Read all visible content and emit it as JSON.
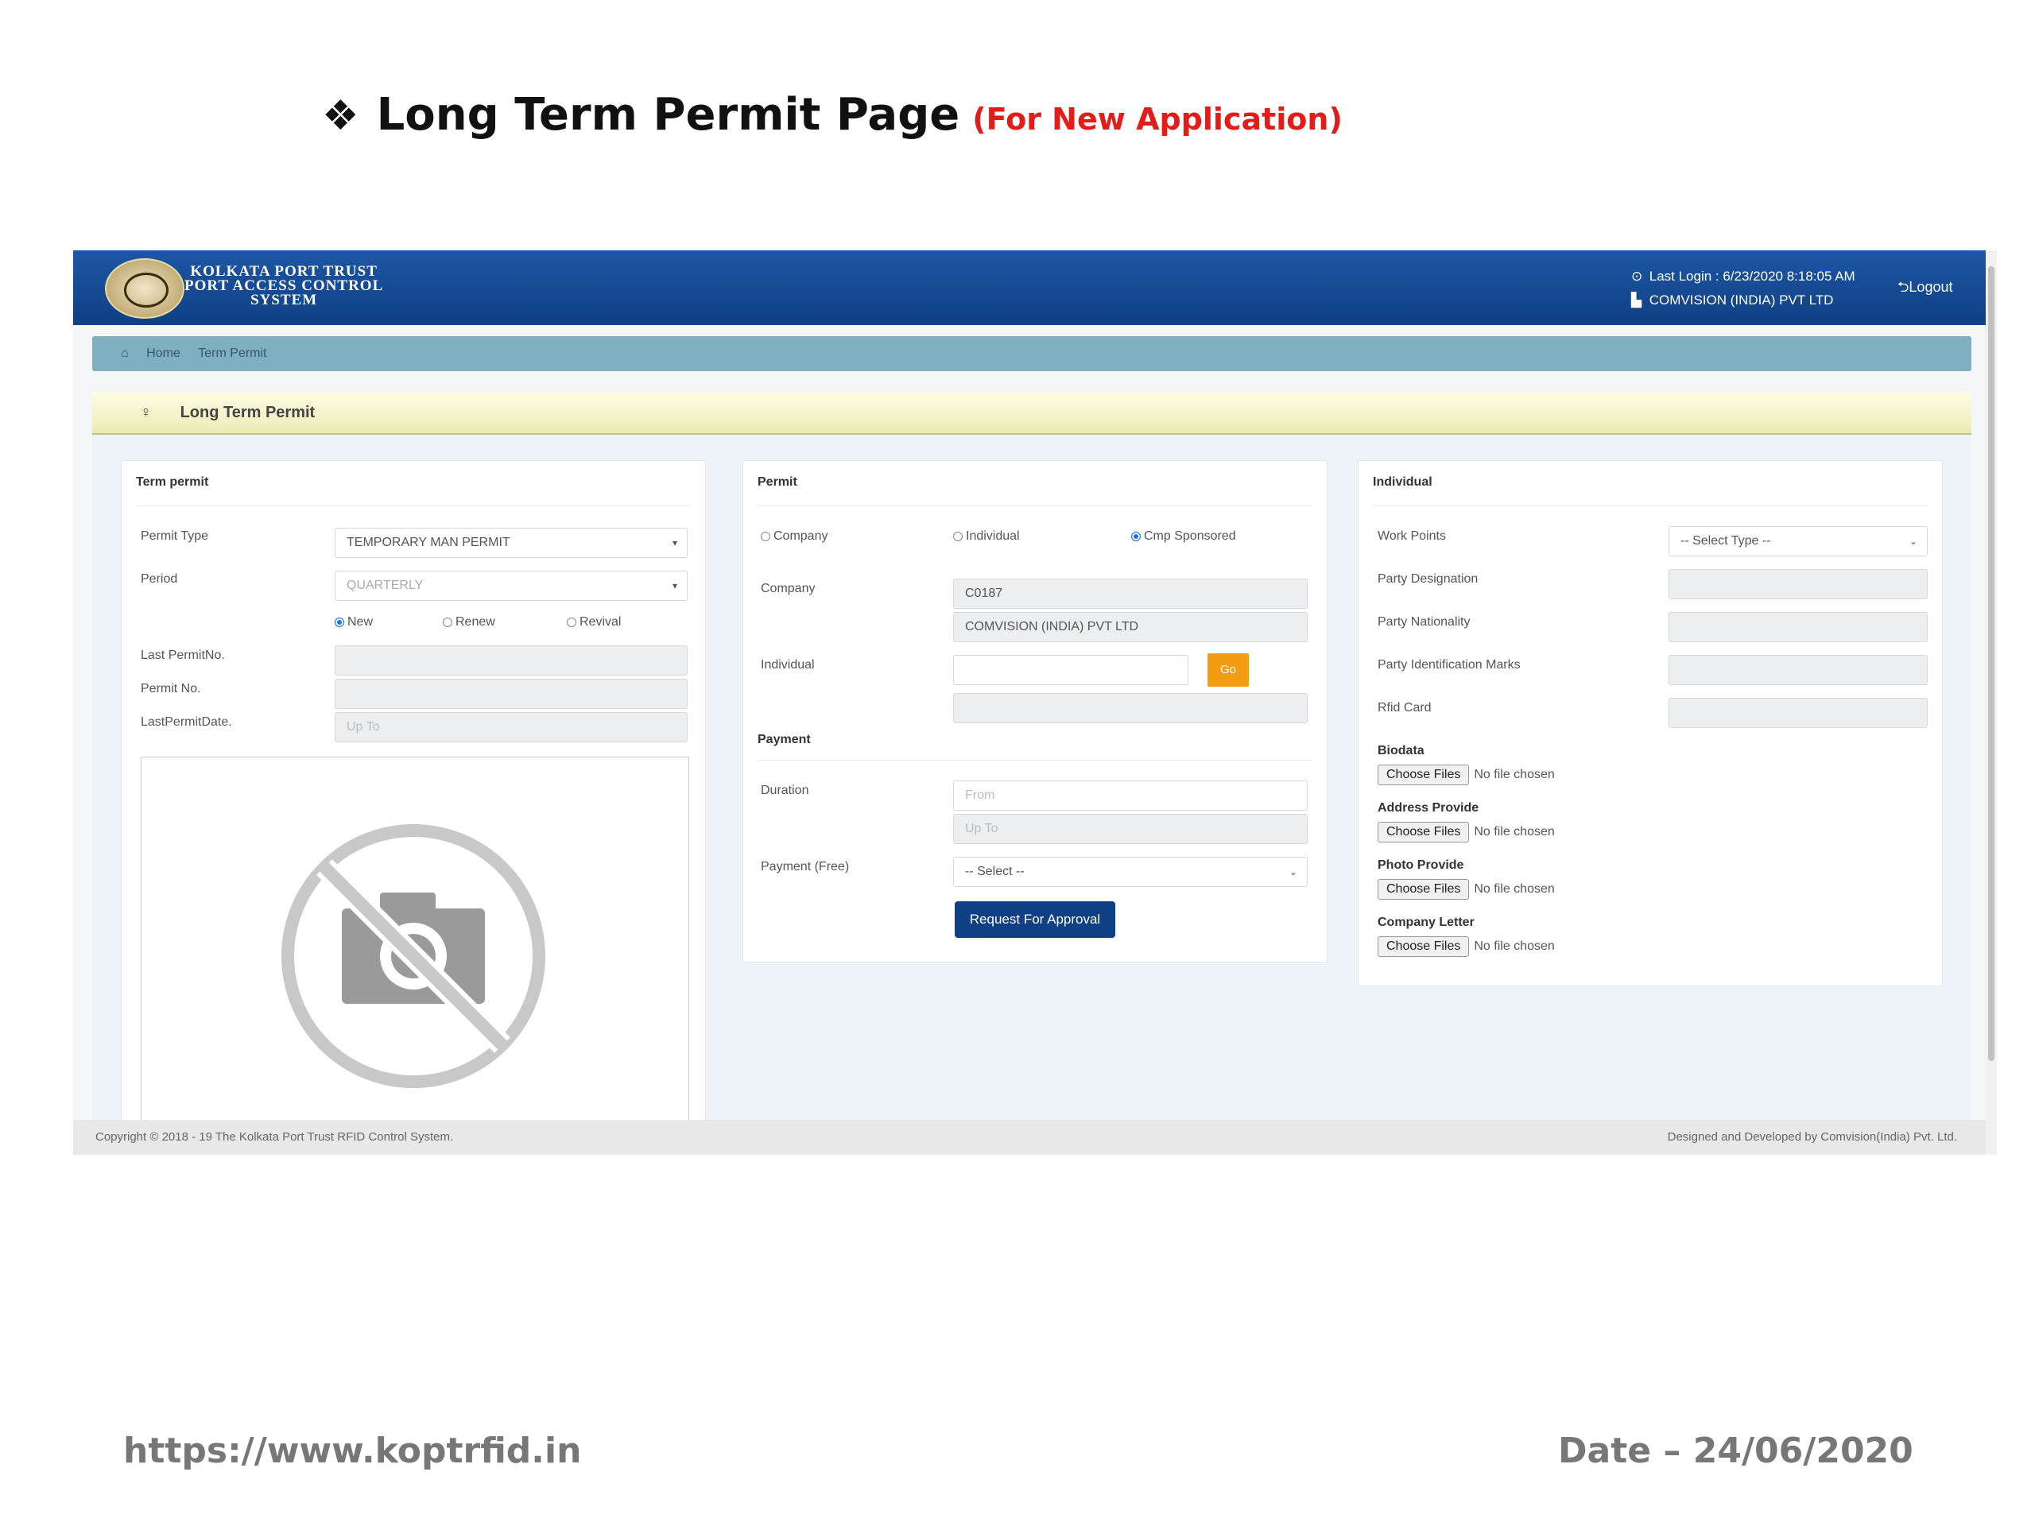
{
  "slide": {
    "bullet": "❖",
    "title": "Long Term Permit Page",
    "subtitle": "(For New Application)",
    "url": "https://www.koptrfid.in",
    "date": "Date – 24/06/2020"
  },
  "header": {
    "brand_line1": "KOLKATA PORT TRUST",
    "brand_line2": "PORT ACCESS CONTROL",
    "brand_line3": "SYSTEM",
    "last_login": "Last Login : 6/23/2020 8:18:05 AM",
    "company": "COMVISION (INDIA) PVT LTD",
    "logout": "Logout"
  },
  "breadcrumb": {
    "home": "Home",
    "current": "Term Permit"
  },
  "panel_title": "Long Term Permit",
  "term_permit": {
    "heading": "Term permit",
    "permit_type_label": "Permit Type",
    "permit_type_value": "TEMPORARY MAN PERMIT",
    "period_label": "Period",
    "period_value": "QUARTERLY",
    "radio_new": "New",
    "radio_renew": "Renew",
    "radio_revival": "Revival",
    "last_permit_no_label": "Last PermitNo.",
    "permit_no_label": "Permit No.",
    "last_permit_date_label": "LastPermitDate.",
    "last_permit_date_placeholder": "Up To"
  },
  "permit": {
    "heading": "Permit",
    "radio_company": "Company",
    "radio_individual": "Individual",
    "radio_cmp_sponsored": "Cmp Sponsored",
    "company_label": "Company",
    "company_code": "C0187",
    "company_name": "COMVISION (INDIA) PVT LTD",
    "individual_label": "Individual",
    "go": "Go",
    "payment_heading": "Payment",
    "duration_label": "Duration",
    "from_placeholder": "From",
    "upto_placeholder": "Up To",
    "payment_free_label": "Payment (Free)",
    "payment_select": "-- Select --",
    "request_button": "Request For Approval"
  },
  "individual": {
    "heading": "Individual",
    "work_points_label": "Work Points",
    "work_points_select": "-- Select Type --",
    "party_designation_label": "Party Designation",
    "party_nationality_label": "Party Nationality",
    "party_identification_label": "Party Identification Marks",
    "rfid_card_label": "Rfid Card",
    "biodata_label": "Biodata",
    "address_label": "Address Provide",
    "photo_label": "Photo Provide",
    "company_letter_label": "Company Letter",
    "choose_files": "Choose Files",
    "no_file": "No file chosen"
  },
  "footer": {
    "copyright": "Copyright © 2018 - 19 The Kolkata Port Trust RFID Control System.",
    "credit": "Designed and Developed by Comvision(India) Pvt. Ltd."
  }
}
